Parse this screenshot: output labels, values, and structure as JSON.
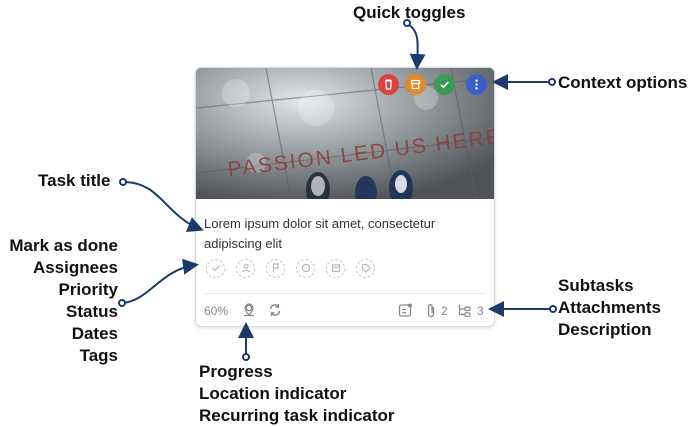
{
  "annotations": {
    "quick_toggles": "Quick toggles",
    "context_options": "Context options",
    "task_title": "Task title",
    "left_group": [
      "Mark as done",
      "Assignees",
      "Priority",
      "Status",
      "Dates",
      "Tags"
    ],
    "bottom_group": [
      "Progress",
      "Location indicator",
      "Recurring task indicator"
    ],
    "right_group": [
      "Subtasks",
      "Attachments",
      "Description"
    ]
  },
  "card": {
    "cover_text": "PASSION LED US HERE",
    "title": "Lorem ipsum dolor sit amet, consectetur adipiscing elit",
    "progress": "60%",
    "attachments_count": "2",
    "subtasks_count": "3"
  },
  "toggles": [
    {
      "icon": "trash-icon",
      "color": "#d9433f"
    },
    {
      "icon": "archive-icon",
      "color": "#e08a2b"
    },
    {
      "icon": "check-icon",
      "color": "#3d9a56"
    },
    {
      "icon": "more-vertical-icon",
      "color": "#3c5fc4"
    }
  ],
  "colors": {
    "arrow": "#1d3a6b"
  }
}
